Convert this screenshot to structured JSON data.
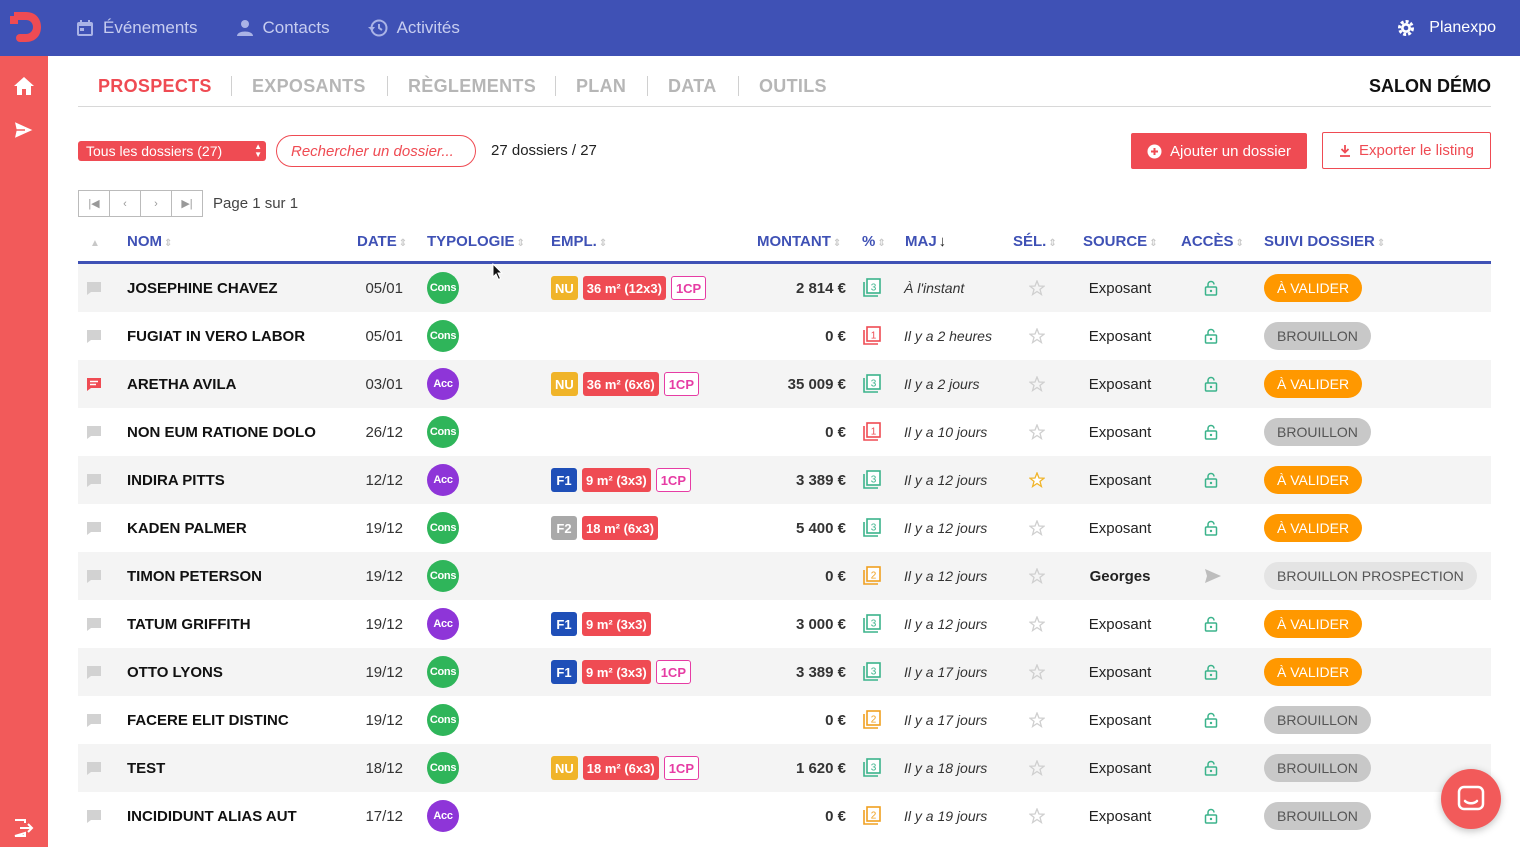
{
  "topbar": {
    "nav": [
      {
        "label": "Événements",
        "icon": "calendar-icon"
      },
      {
        "label": "Contacts",
        "icon": "person-icon"
      },
      {
        "label": "Activités",
        "icon": "history-icon"
      }
    ],
    "org_name": "Planexpo"
  },
  "tabs": [
    {
      "label": "PROSPECTS",
      "active": true
    },
    {
      "label": "EXPOSANTS",
      "active": false
    },
    {
      "label": "RÈGLEMENTS",
      "active": false
    },
    {
      "label": "PLAN",
      "active": false
    },
    {
      "label": "DATA",
      "active": false
    },
    {
      "label": "OUTILS",
      "active": false
    }
  ],
  "salon_name": "SALON DÉMO",
  "filters": {
    "folder_select": "Tous les dossiers (27)",
    "search_placeholder": "Rechercher un dossier...",
    "count_text": "27 dossiers / 27"
  },
  "actions": {
    "add_label": "Ajouter un dossier",
    "export_label": "Exporter le listing"
  },
  "pagination": {
    "text": "Page 1 sur 1"
  },
  "columns": {
    "nom": "NOM",
    "date": "DATE",
    "typologie": "TYPOLOGIE",
    "empl": "EMPL.",
    "montant": "MONTANT",
    "pct": "%",
    "maj": "MAJ",
    "sel": "SÉL.",
    "source": "SOURCE",
    "acces": "ACCÈS",
    "suivi": "SUIVI DOSSIER"
  },
  "colors": {
    "primary": "#3f51b5",
    "accent": "#ef4b53",
    "cons": "#2fb55a",
    "acc": "#8e35d8",
    "nu": "#f0b429",
    "f1": "#1f4fb8",
    "f2": "#a9a9a9",
    "orange": "#ff9800",
    "green_doc": "#3bb38b",
    "red_doc": "#ef4b53",
    "orange_doc": "#f0a020",
    "draft": "#c8c8c8",
    "draft_prospect": "#e4e4e4"
  },
  "rows": [
    {
      "name": "JOSEPHINE CHAVEZ",
      "date": "05/01",
      "typo": "Cons",
      "has_comment": false,
      "zone": "NU",
      "size": "36 m² (12x3)",
      "cp": "1CP",
      "montant": "2 814 €",
      "doc": "3",
      "doc_color": "green",
      "maj": "À l'instant",
      "star": false,
      "source": "Exposant",
      "access": "lock",
      "status": "À VALIDER",
      "status_type": "valider"
    },
    {
      "name": "FUGIAT IN VERO LABOR",
      "date": "05/01",
      "typo": "Cons",
      "has_comment": false,
      "zone": "",
      "size": "",
      "cp": "",
      "montant": "0 €",
      "doc": "1",
      "doc_color": "red",
      "maj": "Il y a 2 heures",
      "star": false,
      "source": "Exposant",
      "access": "lock",
      "status": "BROUILLON",
      "status_type": "brouillon"
    },
    {
      "name": "ARETHA AVILA",
      "date": "03/01",
      "typo": "Acc",
      "has_comment": true,
      "zone": "NU",
      "size": "36 m² (6x6)",
      "cp": "1CP",
      "montant": "35 009 €",
      "doc": "3",
      "doc_color": "green",
      "maj": "Il y a 2 jours",
      "star": false,
      "source": "Exposant",
      "access": "lock",
      "status": "À VALIDER",
      "status_type": "valider"
    },
    {
      "name": "NON EUM RATIONE DOLO",
      "date": "26/12",
      "typo": "Cons",
      "has_comment": false,
      "zone": "",
      "size": "",
      "cp": "",
      "montant": "0 €",
      "doc": "1",
      "doc_color": "red",
      "maj": "Il y a 10 jours",
      "star": false,
      "source": "Exposant",
      "access": "lock",
      "status": "BROUILLON",
      "status_type": "brouillon"
    },
    {
      "name": "INDIRA PITTS",
      "date": "12/12",
      "typo": "Acc",
      "has_comment": false,
      "zone": "F1",
      "size": "9 m² (3x3)",
      "cp": "1CP",
      "montant": "3 389 €",
      "doc": "3",
      "doc_color": "green",
      "maj": "Il y a 12 jours",
      "star": true,
      "source": "Exposant",
      "access": "lock",
      "status": "À VALIDER",
      "status_type": "valider"
    },
    {
      "name": "KADEN PALMER",
      "date": "19/12",
      "typo": "Cons",
      "has_comment": false,
      "zone": "F2",
      "size": "18 m² (6x3)",
      "cp": "",
      "montant": "5 400 €",
      "doc": "3",
      "doc_color": "green",
      "maj": "Il y a 12 jours",
      "star": false,
      "source": "Exposant",
      "access": "lock",
      "status": "À VALIDER",
      "status_type": "valider"
    },
    {
      "name": "TIMON PETERSON",
      "date": "19/12",
      "typo": "Cons",
      "has_comment": false,
      "zone": "",
      "size": "",
      "cp": "",
      "montant": "0 €",
      "doc": "2",
      "doc_color": "orange",
      "maj": "Il y a 12 jours",
      "star": false,
      "source": "Georges",
      "source_bold": true,
      "access": "send",
      "status": "BROUILLON PROSPECTION",
      "status_type": "prospect"
    },
    {
      "name": "TATUM GRIFFITH",
      "date": "19/12",
      "typo": "Acc",
      "has_comment": false,
      "zone": "F1",
      "size": "9 m² (3x3)",
      "cp": "",
      "montant": "3 000 €",
      "doc": "3",
      "doc_color": "green",
      "maj": "Il y a 12 jours",
      "star": false,
      "source": "Exposant",
      "access": "lock",
      "status": "À VALIDER",
      "status_type": "valider"
    },
    {
      "name": "OTTO LYONS",
      "date": "19/12",
      "typo": "Cons",
      "has_comment": false,
      "zone": "F1",
      "size": "9 m² (3x3)",
      "cp": "1CP",
      "montant": "3 389 €",
      "doc": "3",
      "doc_color": "green",
      "maj": "Il y a 17 jours",
      "star": false,
      "source": "Exposant",
      "access": "lock",
      "status": "À VALIDER",
      "status_type": "valider"
    },
    {
      "name": "FACERE ELIT DISTINC",
      "date": "19/12",
      "typo": "Cons",
      "has_comment": false,
      "zone": "",
      "size": "",
      "cp": "",
      "montant": "0 €",
      "doc": "2",
      "doc_color": "orange",
      "maj": "Il y a 17 jours",
      "star": false,
      "source": "Exposant",
      "access": "lock",
      "status": "BROUILLON",
      "status_type": "brouillon"
    },
    {
      "name": "TEST",
      "date": "18/12",
      "typo": "Cons",
      "has_comment": false,
      "zone": "NU",
      "size": "18 m² (6x3)",
      "cp": "1CP",
      "montant": "1 620 €",
      "doc": "3",
      "doc_color": "green",
      "maj": "Il y a 18 jours",
      "star": false,
      "source": "Exposant",
      "access": "lock",
      "status": "BROUILLON",
      "status_type": "brouillon"
    },
    {
      "name": "INCIDIDUNT ALIAS AUT",
      "date": "17/12",
      "typo": "Acc",
      "has_comment": false,
      "zone": "",
      "size": "",
      "cp": "",
      "montant": "0 €",
      "doc": "2",
      "doc_color": "orange",
      "maj": "Il y a 19 jours",
      "star": false,
      "source": "Exposant",
      "access": "lock",
      "status": "BROUILLON",
      "status_type": "brouillon"
    }
  ]
}
